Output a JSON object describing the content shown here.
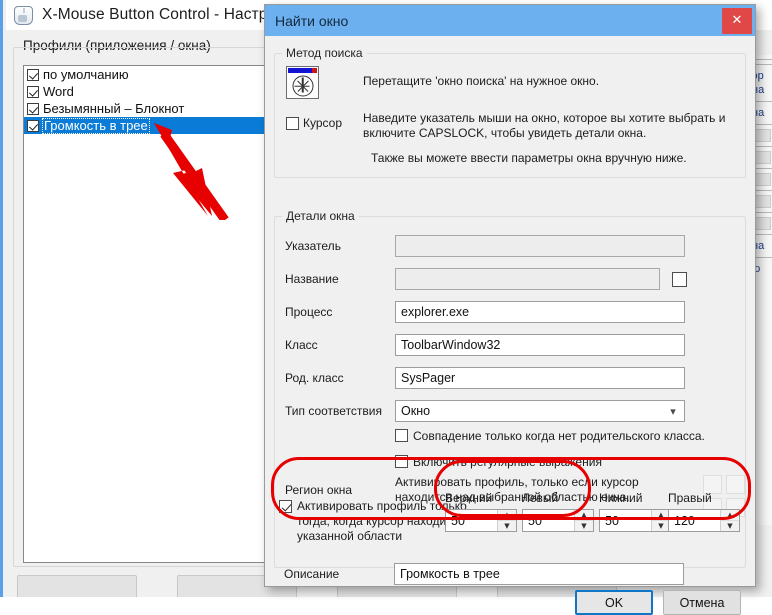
{
  "main_window": {
    "title": "X-Mouse Button Control - Настрой",
    "icon": "mouse-icon",
    "profiles_group_label": "Профили (приложения / окна)",
    "profiles": [
      {
        "label": "по умолчанию",
        "checked": true,
        "selected": false
      },
      {
        "label": "Word",
        "checked": true,
        "selected": false
      },
      {
        "label": "Безымянный – Блокнот",
        "checked": true,
        "selected": false
      },
      {
        "label": "Громкость в трее",
        "checked": true,
        "selected": true
      }
    ],
    "background_fragments": [
      "эр",
      "на",
      "на",
      "на",
      "ю"
    ]
  },
  "dialog": {
    "title": "Найти окно",
    "close_label": "✕",
    "method_group": {
      "legend": "Метод поиска",
      "drag_icon": "window-target-icon",
      "drag_text": "Перетащите 'окно поиска' на нужное окно.",
      "cursor_checkbox_label": "Курсор",
      "cursor_checked": false,
      "cursor_text": "Наведите указатель мыши на окно, которое вы хотите выбрать и включите CAPSLOCK, чтобы увидеть детали окна.",
      "manual_text": "Также вы можете ввести параметры окна вручную ниже."
    },
    "details_group": {
      "legend": "Детали окна",
      "fields": [
        {
          "label": "Указатель",
          "value": "",
          "disabled": true
        },
        {
          "label": "Название",
          "value": "",
          "disabled": true,
          "side_checkbox": true,
          "side_checked": false
        },
        {
          "label": "Процесс",
          "value": "explorer.exe",
          "disabled": false
        },
        {
          "label": "Класс",
          "value": "ToolbarWindow32",
          "disabled": false
        },
        {
          "label": "Род. класс",
          "value": "SysPager",
          "disabled": false
        }
      ],
      "match_type_label": "Тип соответствия",
      "match_type_value": "Окно",
      "match_type_chevron": "chevron-down-icon",
      "option_no_parent": "Совпадение только когда нет родительского класса.",
      "option_no_parent_checked": false,
      "option_regex": "Включить регулярные выражения",
      "option_regex_checked": false,
      "region_label": "Регион окна",
      "region_text": "Активировать профиль, только если курсор находится над выбранной областью окна.",
      "region_grid_cells": 4
    },
    "region_activation": {
      "checkbox_label": "Активировать профиль только тогда, когда курсор находится в указанной области",
      "checked": true,
      "spinners": [
        {
          "label": "Верхний",
          "value": "50"
        },
        {
          "label": "Левый",
          "value": "50"
        },
        {
          "label": "Нижний",
          "value": "50"
        },
        {
          "label": "Правый",
          "value": "120"
        }
      ],
      "spin_up": "▲",
      "spin_down": "▼"
    },
    "description_label": "Описание",
    "description_value": "Громкость в трее",
    "buttons": {
      "ok": "OK",
      "cancel": "Отмена"
    }
  },
  "annotations": {
    "arrow_color": "#e60000",
    "oval_color": "#e60000",
    "arrow_target": "Громкость в трее"
  },
  "colors": {
    "selection_blue": "#0a7bd6",
    "dialog_titlebar": "#6cb0ef",
    "close_red": "#e04848",
    "annotation_red": "#e60000",
    "window_bg": "#f0f0f0"
  }
}
